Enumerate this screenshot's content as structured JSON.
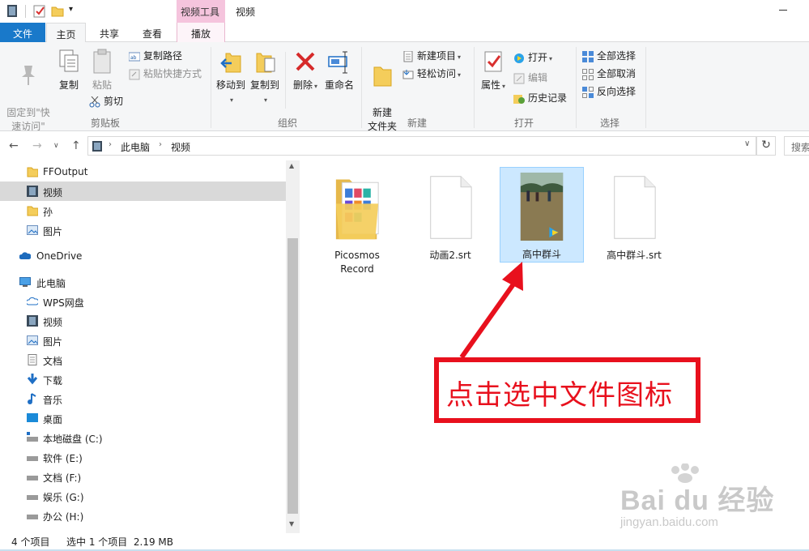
{
  "title_bar": {
    "contextual_group": "视频工具",
    "window_title": "视频"
  },
  "ribbon_tabs": {
    "file": "文件",
    "home": "主页",
    "share": "共享",
    "view": "查看",
    "play": "播放"
  },
  "ribbon": {
    "clipboard": {
      "pin_quick_access": "固定到\"快\n速访问\"",
      "copy": "复制",
      "paste": "粘贴",
      "copy_path": "复制路径",
      "paste_shortcut": "粘贴快捷方式",
      "cut": "剪切",
      "group_label": "剪贴板"
    },
    "organize": {
      "move_to": "移动到",
      "copy_to": "复制到",
      "delete": "删除",
      "rename": "重命名",
      "group_label": "组织"
    },
    "new": {
      "new_folder": "新建\n文件夹",
      "new_item": "新建项目",
      "easy_access": "轻松访问",
      "group_label": "新建"
    },
    "open": {
      "properties": "属性",
      "open": "打开",
      "edit": "编辑",
      "history": "历史记录",
      "group_label": "打开"
    },
    "select": {
      "select_all": "全部选择",
      "select_none": "全部取消",
      "invert_selection": "反向选择",
      "group_label": "选择"
    }
  },
  "address": {
    "segments": [
      "此电脑",
      "视频"
    ],
    "search_placeholder": "搜索"
  },
  "nav_pane": {
    "items": [
      {
        "label": "FFOutput",
        "icon": "folder-icon"
      },
      {
        "label": "视频",
        "icon": "video-folder-icon"
      },
      {
        "label": "孙",
        "icon": "folder-icon"
      },
      {
        "label": "图片",
        "icon": "pictures-icon"
      },
      {
        "label": "OneDrive",
        "icon": "cloud-icon"
      },
      {
        "label": "此电脑",
        "icon": "computer-icon"
      },
      {
        "label": "WPS网盘",
        "icon": "cloud-icon"
      },
      {
        "label": "视频",
        "icon": "video-folder-icon"
      },
      {
        "label": "图片",
        "icon": "pictures-icon"
      },
      {
        "label": "文档",
        "icon": "documents-icon"
      },
      {
        "label": "下载",
        "icon": "download-icon"
      },
      {
        "label": "音乐",
        "icon": "music-icon"
      },
      {
        "label": "桌面",
        "icon": "desktop-icon"
      },
      {
        "label": "本地磁盘 (C:)",
        "icon": "drive-icon"
      },
      {
        "label": "软件 (E:)",
        "icon": "drive-icon"
      },
      {
        "label": "文档 (F:)",
        "icon": "drive-icon"
      },
      {
        "label": "娱乐 (G:)",
        "icon": "drive-icon"
      },
      {
        "label": "办公 (H:)",
        "icon": "drive-icon"
      }
    ]
  },
  "files": [
    {
      "name": "Picosmos\nRecord",
      "type": "folder"
    },
    {
      "name": "动画2.srt",
      "type": "document"
    },
    {
      "name": "高中群斗",
      "type": "video",
      "selected": true
    },
    {
      "name": "高中群斗.srt",
      "type": "document"
    }
  ],
  "status": {
    "item_count": "4 个项目",
    "selection": "选中 1 个项目  2.19 MB"
  },
  "annotation": {
    "text": "点击选中文件图标"
  },
  "watermark": {
    "logo": "Bai du 经验",
    "url": "jingyan.baidu.com"
  },
  "colors": {
    "accent": "#1979ca",
    "selection": "#cce8ff",
    "annotation_red": "#e8101d",
    "contextual_pink": "#f5c4dd"
  }
}
